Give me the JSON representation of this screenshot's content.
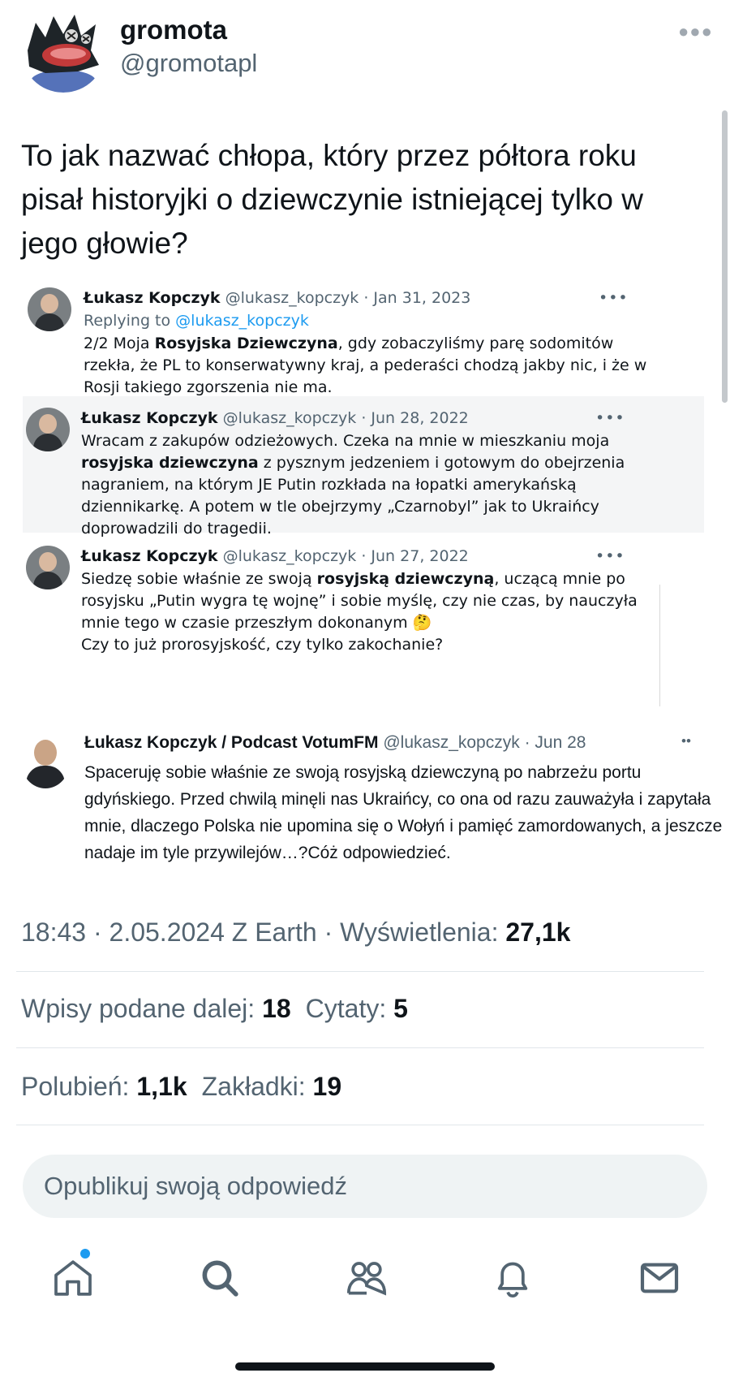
{
  "author": {
    "name": "gromota",
    "handle": "@gromotapl"
  },
  "tweet": {
    "text": "To jak nazwać chłopa, który przez półtora roku pisał historyjki o dziewczynie istniejącej tylko w jego głowie?"
  },
  "embedded": [
    {
      "name": "Łukasz Kopczyk",
      "handle_date": "@lukasz_kopczyk · Jan 31, 2023",
      "reply_prefix": "Replying to",
      "reply_to": "@lukasz_kopczyk",
      "text_a": "2/2 Moja ",
      "bold": "Rosyjska Dziewczyna",
      "text_b": ", gdy zobaczyliśmy parę sodomitów rzekła, że PL to konserwatywny kraj, a pederaści chodzą jakby nic, i że w Rosji takiego zgorszenia nie ma."
    },
    {
      "name": "Łukasz Kopczyk",
      "handle_date": "@lukasz_kopczyk · Jun 28, 2022",
      "text_a": "Wracam z zakupów odzieżowych. Czeka na mnie w mieszkaniu moja ",
      "bold": "rosyjska dziewczyna",
      "text_b": " z pysznym jedzeniem i gotowym do obejrzenia nagraniem, na którym JE Putin rozkłada na łopatki amerykańską dziennikarkę. A potem w tle obejrzymy „Czarnobyl” jak to Ukraińcy doprowadzili do tragedii."
    },
    {
      "name": "Łukasz Kopczyk",
      "handle_date": "@lukasz_kopczyk · Jun 27, 2022",
      "text_a": "Siedzę sobie właśnie ze swoją ",
      "bold": "rosyjską dziewczyną",
      "text_b": ", uczącą mnie po rosyjsku „Putin wygra tę wojnę” i sobie myślę, czy nie czas, by nauczyła mnie tego w czasie przeszłym dokonanym 🤔",
      "text_c": "Czy to już prorosyjskość, czy tylko zakochanie?"
    }
  ],
  "last_embedded": {
    "name": "Łukasz Kopczyk / Podcast VotumFM",
    "handle_date": "@lukasz_kopczyk · Jun 28",
    "text": "Spaceruję sobie właśnie ze swoją rosyjską dziewczyną po nabrzeżu portu gdyńskiego. Przed chwilą minęli nas Ukraińcy, co ona od razu zauważyła i zapytała mnie, dlaczego Polska nie upomina się o Wołyń i pamięć zamordowanych, a jeszcze nadaje im tyle przywilejów…?Cóż odpowiedzieć."
  },
  "meta": {
    "timestamp": "18:43 · 2.05.2024 Z Earth · Wyświetlenia: ",
    "views": "27,1k"
  },
  "stats": {
    "reposts_label": "Wpisy podane dalej: ",
    "reposts": "18",
    "quotes_label": "Cytaty: ",
    "quotes": "5",
    "likes_label": "Polubień: ",
    "likes": "1,1k",
    "bookmarks_label": "Zakładki: ",
    "bookmarks": "19"
  },
  "reply": {
    "placeholder": "Opublikuj swoją odpowiedź"
  },
  "nav": {
    "items": [
      "home-icon",
      "search-icon",
      "communities-icon",
      "notifications-icon",
      "messages-icon"
    ],
    "accent": "#1d9bf0"
  }
}
